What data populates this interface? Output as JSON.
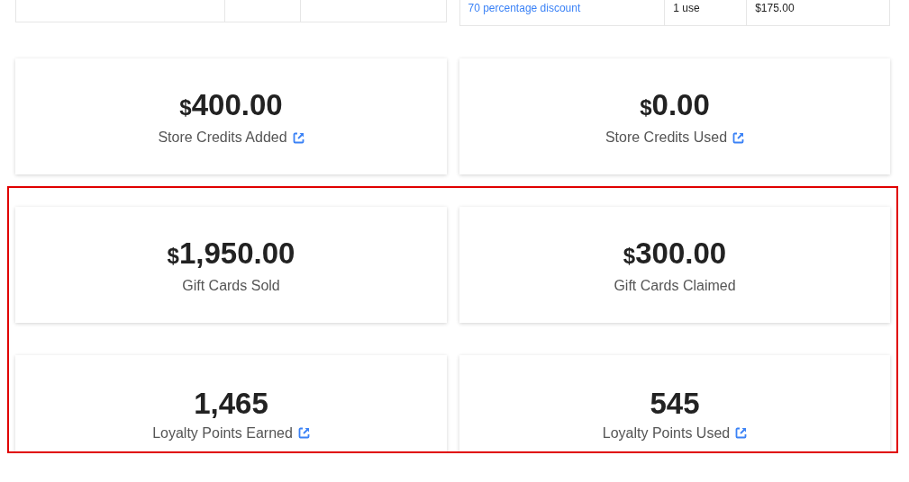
{
  "right_table": {
    "rows": [
      {
        "cells": [
          {
            "text": "70 percentage discount",
            "kind": "link"
          },
          {
            "text": "1 use",
            "kind": "text"
          },
          {
            "text": "$175.00",
            "kind": "text"
          }
        ]
      }
    ]
  },
  "stat_cards": [
    {
      "currency": "$",
      "value": "400.00",
      "label": "Store Credits Added",
      "link": true
    },
    {
      "currency": "$",
      "value": "0.00",
      "label": "Store Credits Used",
      "link": true
    }
  ],
  "highlighted_cards": [
    {
      "currency": "$",
      "value": "1,950.00",
      "label": "Gift Cards Sold",
      "link": false
    },
    {
      "currency": "$",
      "value": "300.00",
      "label": "Gift Cards Claimed",
      "link": false
    },
    {
      "value": "1,465",
      "label": "Loyalty Points Earned",
      "link": true
    },
    {
      "value": "545",
      "label": "Loyalty Points Used",
      "link": true
    }
  ]
}
